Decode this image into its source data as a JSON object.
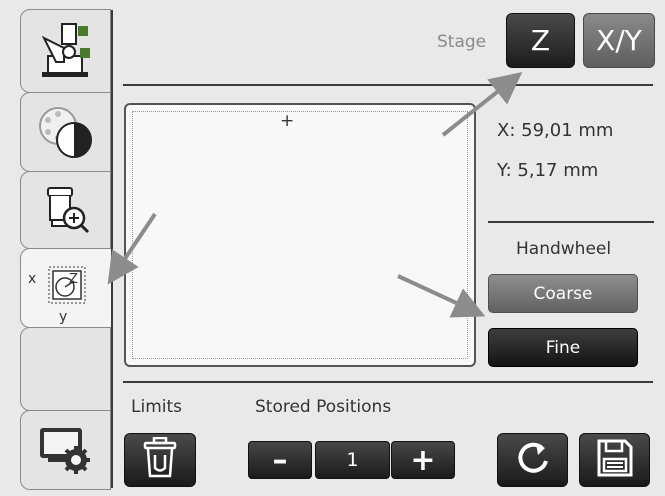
{
  "tabs": [
    {
      "name": "microscope-icon"
    },
    {
      "name": "contrast-icon"
    },
    {
      "name": "objective-zoom-icon"
    },
    {
      "name": "xy-stage-icon",
      "x_label": "x",
      "y_label": "y"
    },
    {
      "name": "settings-icon"
    }
  ],
  "header": {
    "stage_label": "Stage",
    "z_button": "Z",
    "xy_button": "X/Y"
  },
  "map": {
    "marker": "+"
  },
  "position": {
    "x": "X: 59,01 mm",
    "y": "Y: 5,17 mm"
  },
  "handwheel": {
    "label": "Handwheel",
    "coarse": "Coarse",
    "fine": "Fine"
  },
  "bottom": {
    "limits_label": "Limits",
    "stored_label": "Stored Positions",
    "minus": "–",
    "position_value": "1",
    "plus": "+"
  },
  "icons": {
    "limits": "trash-icon",
    "refresh": "refresh-icon",
    "save": "save-icon"
  },
  "colors": {
    "annotation_arrow": "#8c8c8c",
    "dark_button": "#2a2a2a",
    "mid_button": "#707070"
  }
}
